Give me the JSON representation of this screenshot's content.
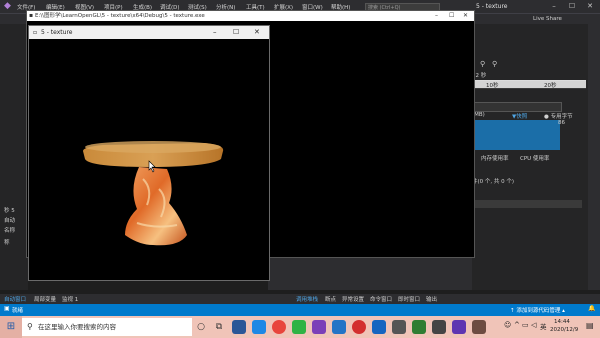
{
  "vs": {
    "menu": [
      "文件(F)",
      "编辑(E)",
      "视图(V)",
      "项目(P)",
      "生成(B)",
      "调试(D)",
      "测试(S)",
      "分析(N)",
      "工具(T)",
      "扩展(X)",
      "窗口(W)",
      "帮助(H)"
    ],
    "search_placeholder": "搜索 (Ctrl+Q)",
    "title": "5 - texture",
    "live_share": "Live Share",
    "right_panel": {
      "seconds": "22 秒",
      "tick1": "10秒",
      "tick2": "20秒",
      "mem_label": "(MB)",
      "snapshot": "快照",
      "private_bytes": "专用字节",
      "value": "86",
      "tab1": "内存使用率",
      "tab2": "CPU 使用率",
      "events": "件(0 个, 共 0 个)"
    },
    "left_labels": [
      "秒 5",
      "自动",
      "名称",
      "称"
    ],
    "bottom_tabs_left": [
      "自动窗口",
      "局部变量",
      "监视 1"
    ],
    "bottom_tabs_right": [
      "调用堆栈",
      "断点",
      "异常设置",
      "命令窗口",
      "即时窗口",
      "输出"
    ],
    "status_left": "就绪",
    "status_right": "添加到源代码管理"
  },
  "console": {
    "title": "E:\\\\图形学\\LearnOpenGL\\5 - texture\\x64\\Debug\\5 - texture.exe"
  },
  "glwindow": {
    "title": "5 - texture"
  },
  "taskbar": {
    "search_placeholder": "在这里输入你要搜索的内容",
    "time": "14:44",
    "date": "2020/12/9",
    "lang": "英"
  },
  "colors": {
    "accent": "#007acc",
    "taskbar": "#f0c4b8"
  }
}
